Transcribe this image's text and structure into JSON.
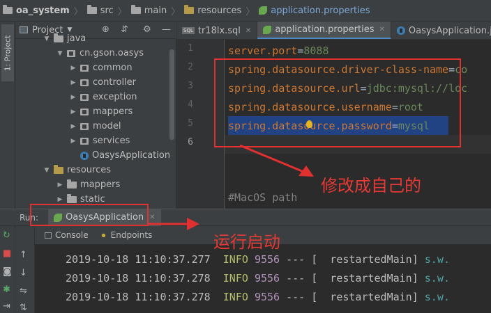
{
  "breadcrumb": [
    {
      "label": "oa_system",
      "icon": "folder-icon",
      "style": "bold"
    },
    {
      "label": "src",
      "icon": "folder-icon"
    },
    {
      "label": "main",
      "icon": "folder-icon"
    },
    {
      "label": "resources",
      "icon": "resources-folder-icon"
    },
    {
      "label": "application.properties",
      "icon": "spring-leaf-icon",
      "style": "active"
    }
  ],
  "side_strip": {
    "tab_label": "1: Project"
  },
  "project_panel": {
    "title": "Project",
    "tree": [
      {
        "label": "java",
        "indent": 0,
        "expanded": true,
        "icon": "folder-icon",
        "partial": true
      },
      {
        "label": "cn.gson.oasys",
        "indent": 1,
        "expanded": true,
        "icon": "package-icon"
      },
      {
        "label": "common",
        "indent": 2,
        "expanded": false,
        "icon": "package-icon"
      },
      {
        "label": "controller",
        "indent": 2,
        "expanded": false,
        "icon": "package-icon"
      },
      {
        "label": "exception",
        "indent": 2,
        "expanded": false,
        "icon": "package-icon"
      },
      {
        "label": "mappers",
        "indent": 2,
        "expanded": false,
        "icon": "package-icon"
      },
      {
        "label": "model",
        "indent": 2,
        "expanded": false,
        "icon": "package-icon"
      },
      {
        "label": "services",
        "indent": 2,
        "expanded": false,
        "icon": "package-icon"
      },
      {
        "label": "OasysApplication",
        "indent": 2,
        "leaf": true,
        "icon": "spring-boot-class-icon"
      },
      {
        "label": "resources",
        "indent": 0,
        "expanded": true,
        "icon": "resources-folder-icon"
      },
      {
        "label": "mappers",
        "indent": 1,
        "expanded": false,
        "icon": "folder-icon"
      },
      {
        "label": "static",
        "indent": 1,
        "expanded": false,
        "icon": "folder-icon",
        "partial": true
      }
    ]
  },
  "editor_tabs": [
    {
      "label": "tr18lx.sql",
      "icon": "sql-file-icon",
      "active": false
    },
    {
      "label": "application.properties",
      "icon": "spring-leaf-icon",
      "active": true
    },
    {
      "label": "OasysApplication.java",
      "icon": "java-class-icon",
      "active": false
    }
  ],
  "editor": {
    "line_numbers": [
      "1",
      "2",
      "3",
      "4",
      "5",
      "6"
    ],
    "lines": [
      {
        "key": "server.port",
        "eq": "=",
        "value": "8088"
      },
      {
        "key": "spring.datasource.driver-class-name",
        "eq": "=",
        "value": "co"
      },
      {
        "key": "spring.datasource.url",
        "eq": "=",
        "value": "jdbc:mysql://loc"
      },
      {
        "key": "spring.datasource.username",
        "eq": "=",
        "value": "root"
      },
      {
        "key": "spring.datasource.password",
        "eq": "=",
        "value": "mysql"
      }
    ],
    "comment": "#MacOS path"
  },
  "run_panel": {
    "label": "Run:",
    "tab_label": "OasysApplication",
    "subtabs": [
      {
        "label": "Console"
      },
      {
        "label": "Endpoints"
      }
    ],
    "log_lines": [
      {
        "timestamp": "2019-10-18 11:10:37.277",
        "level": "INFO",
        "pid": "9556",
        "dash": "---",
        "thread": "[  restartedMain]",
        "logger": "s.w."
      },
      {
        "timestamp": "2019-10-18 11:10:37.278",
        "level": "INFO",
        "pid": "9556",
        "dash": "---",
        "thread": "[  restartedMain]",
        "logger": "s.w."
      },
      {
        "timestamp": "2019-10-18 11:10:37.278",
        "level": "INFO",
        "pid": "9556",
        "dash": "---",
        "thread": "[  restartedMain]",
        "logger": "s.w."
      }
    ]
  },
  "annotations": {
    "edit_note": "修改成自己的",
    "run_note": "运行启动",
    "color": "#e03030"
  }
}
